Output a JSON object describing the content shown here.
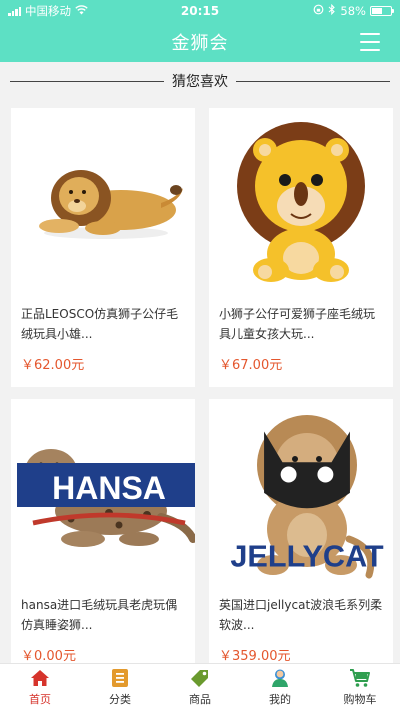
{
  "status_bar": {
    "carrier": "中国移动",
    "time": "20:15",
    "battery": "58%",
    "battery_level": 0.58
  },
  "header": {
    "title": "金狮会",
    "menu_icon": "hamburger-menu-icon"
  },
  "section": {
    "title": "猜您喜欢"
  },
  "products": [
    {
      "name": "正品LEOSCO仿真狮子公仔毛绒玩具小雄...",
      "price": "￥62.00元",
      "image": "lying-lion-plush",
      "brand": ""
    },
    {
      "name": "小狮子公仔可爱狮子座毛绒玩具儿童女孩大玩...",
      "price": "￥67.00元",
      "image": "cartoon-lion-plush",
      "brand": ""
    },
    {
      "name": "hansa进口毛绒玩具老虎玩偶仿真睡姿狮...",
      "price": "￥0.00元",
      "image": "lying-leopard-plush",
      "brand": "HANSA"
    },
    {
      "name": "英国进口jellycat波浪毛系列柔软波...",
      "price": "￥359.00元",
      "image": "jellycat-lion-plush",
      "brand": "JELLYCAT"
    }
  ],
  "tabbar": {
    "items": [
      {
        "label": "首页",
        "icon": "home-icon",
        "active": true
      },
      {
        "label": "分类",
        "icon": "category-icon",
        "active": false
      },
      {
        "label": "商品",
        "icon": "tag-icon",
        "active": false
      },
      {
        "label": "我的",
        "icon": "user-icon",
        "active": false
      },
      {
        "label": "购物车",
        "icon": "cart-icon",
        "active": false
      }
    ]
  },
  "colors": {
    "primary": "#5de0c4",
    "price": "#e4572e",
    "active_tab": "#d6342c"
  }
}
